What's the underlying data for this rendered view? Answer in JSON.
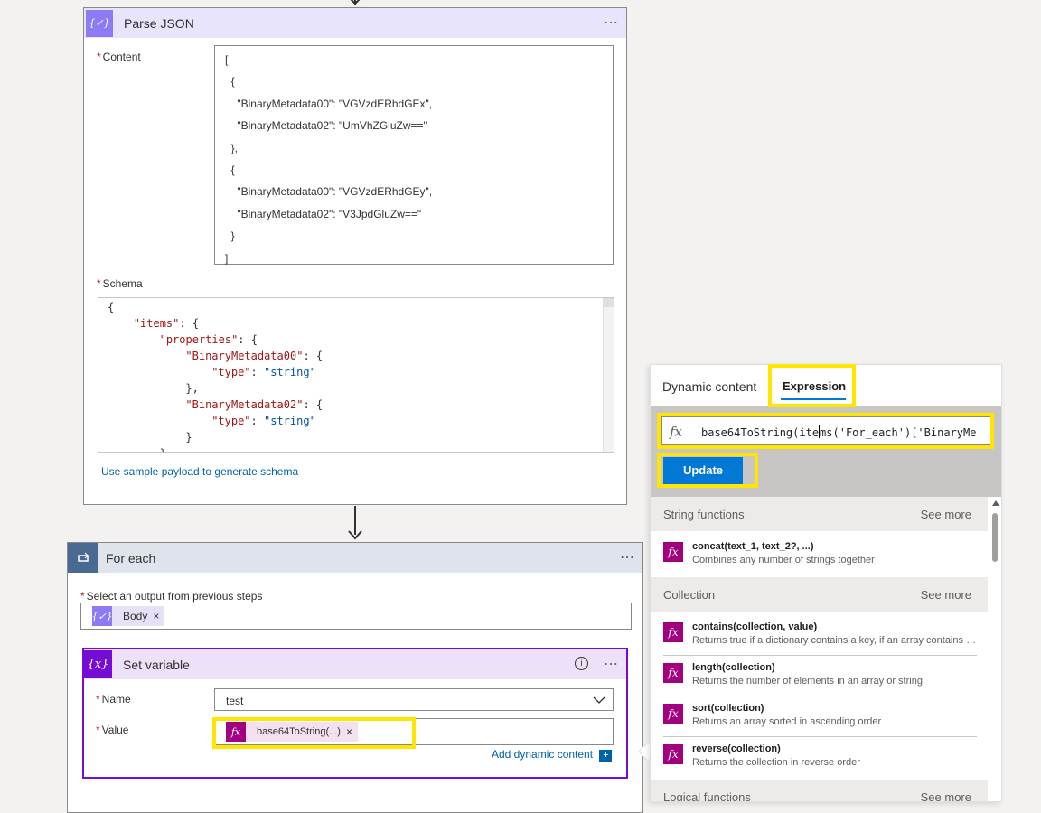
{
  "parse_json": {
    "title": "Parse JSON",
    "more": "⋯",
    "content_label": "Content",
    "content_lines": [
      "[",
      "  {",
      "    \"BinaryMetadata00\": \"VGVzdERhdGEx\",",
      "    \"BinaryMetadata02\": \"UmVhZGluZw==\"",
      "  },",
      "  {",
      "    \"BinaryMetadata00\": \"VGVzdERhdGEy\",",
      "    \"BinaryMetadata02\": \"V3JpdGluZw==\"",
      "  }",
      "]"
    ],
    "schema_label": "Schema",
    "schema_lines": [
      {
        "indent": 0,
        "key": "",
        "rest": "{"
      },
      {
        "indent": 4,
        "key": "\"items\"",
        "rest": ": {"
      },
      {
        "indent": 8,
        "key": "\"properties\"",
        "rest": ": {"
      },
      {
        "indent": 12,
        "key": "\"BinaryMetadata00\"",
        "rest": ": {"
      },
      {
        "indent": 16,
        "key": "\"type\"",
        "rest": ": ",
        "str": "\"string\""
      },
      {
        "indent": 12,
        "key": "",
        "rest": "},"
      },
      {
        "indent": 12,
        "key": "\"BinaryMetadata02\"",
        "rest": ": {"
      },
      {
        "indent": 16,
        "key": "\"type\"",
        "rest": ": ",
        "str": "\"string\""
      },
      {
        "indent": 12,
        "key": "",
        "rest": "}"
      },
      {
        "indent": 8,
        "key": "",
        "rest": "}"
      }
    ],
    "sample_link": "Use sample payload to generate schema"
  },
  "for_each": {
    "title": "For each",
    "more": "⋯",
    "select_label": "Select an output from previous steps",
    "token_label": "Body",
    "token_close": "×"
  },
  "set_variable": {
    "title": "Set variable",
    "info": "i",
    "more": "⋯",
    "name_label": "Name",
    "name_value": "test",
    "value_label": "Value",
    "value_token": "base64ToString(...)",
    "value_token_close": "×",
    "add_dynamic": "Add dynamic content",
    "add_dynamic_plus": "+"
  },
  "panel": {
    "tabs": [
      "Dynamic content",
      "Expression"
    ],
    "active_tab": "Expression",
    "fx": "fx",
    "expression_before_cursor": "base64ToString(ite",
    "expression_after_cursor": "ms('For_each')['BinaryMe",
    "update_label": "Update",
    "sections": [
      {
        "name": "String functions",
        "see_more": "See more",
        "functions": [
          {
            "name": "concat(text_1, text_2?, ...)",
            "desc": "Combines any number of strings together"
          }
        ]
      },
      {
        "name": "Collection",
        "see_more": "See more",
        "functions": [
          {
            "name": "contains(collection, value)",
            "desc": "Returns true if a dictionary contains a key, if an array contains a value, or if a string contains a substring"
          },
          {
            "name": "length(collection)",
            "desc": "Returns the number of elements in an array or string"
          },
          {
            "name": "sort(collection)",
            "desc": "Returns an array sorted in ascending order"
          },
          {
            "name": "reverse(collection)",
            "desc": "Returns the collection in reverse order"
          }
        ]
      },
      {
        "name": "Logical functions",
        "see_more": "See more",
        "functions": []
      }
    ]
  },
  "colors": {
    "parse_json_accent": "#8b7cf6",
    "for_each_accent": "#486991",
    "set_variable_accent": "#770bd6",
    "function_icon": "#a2007e",
    "update_button": "#0078d4",
    "highlight": "#ffe500"
  }
}
